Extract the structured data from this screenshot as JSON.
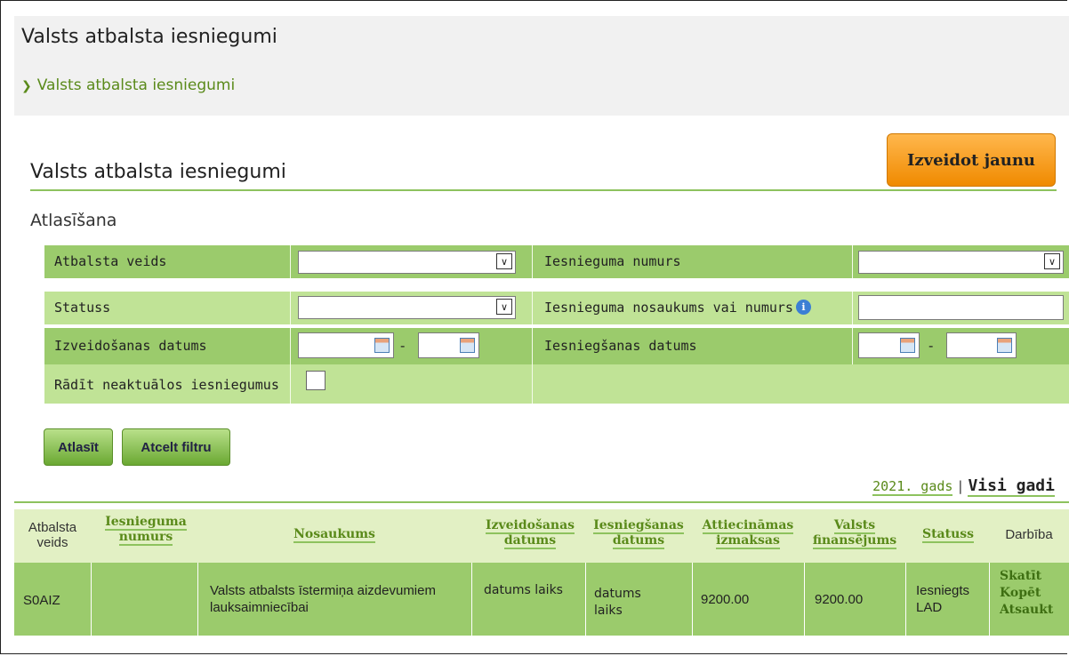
{
  "page": {
    "title": "Valsts atbalsta iesniegumi",
    "breadcrumb": "Valsts atbalsta iesniegumi",
    "section_title": "Valsts atbalsta iesniegumi",
    "create_button": "Izveidot jaunu"
  },
  "filter": {
    "title": "Atlasīšana",
    "support_type_label": "Atbalsta veids",
    "application_number_label": "Iesnieguma numurs",
    "status_label": "Statuss",
    "application_name_label": "Iesnieguma nosaukums vai numurs",
    "created_date_label": "Izveidošanas datums",
    "submitted_date_label": "Iesniegšanas datums",
    "show_inactive_label": "Rādīt neaktuālos iesniegumus",
    "date_separator": "-",
    "info_icon_glyph": "i",
    "select_arrow": "▾"
  },
  "buttons": {
    "apply": "Atlasīt",
    "clear": "Atcelt filtru"
  },
  "years": {
    "current": "2021. gads",
    "separator": "|",
    "all": "Visi gadi"
  },
  "table": {
    "headers": {
      "support_type": "Atbalsta veids",
      "number": "Iesnieguma numurs",
      "name": "Nosaukums",
      "created": "Izveidošanas datums",
      "submitted": "Iesniegšanas datums",
      "eligible_costs": "Attiecināmas izmaksas",
      "state_funding": "Valsts finansējums",
      "status": "Statuss",
      "actions": "Darbība"
    },
    "rows": [
      {
        "support_type": "S0AIZ",
        "number": "",
        "name": "Valsts atbalsts īstermiņa aizdevumiem lauksaimniecībai",
        "created": "datums laiks",
        "submitted": "datums laiks",
        "eligible_costs": "9200.00",
        "state_funding": "9200.00",
        "status": "Iesniegts LAD",
        "actions": [
          "Skatīt",
          "Kopēt",
          "Atsaukt"
        ]
      }
    ]
  },
  "colors": {
    "accent_green": "#5a8a1a",
    "row_dark": "#9bcb6c",
    "row_light": "#c0e396",
    "orange_button": "#f59a12"
  }
}
